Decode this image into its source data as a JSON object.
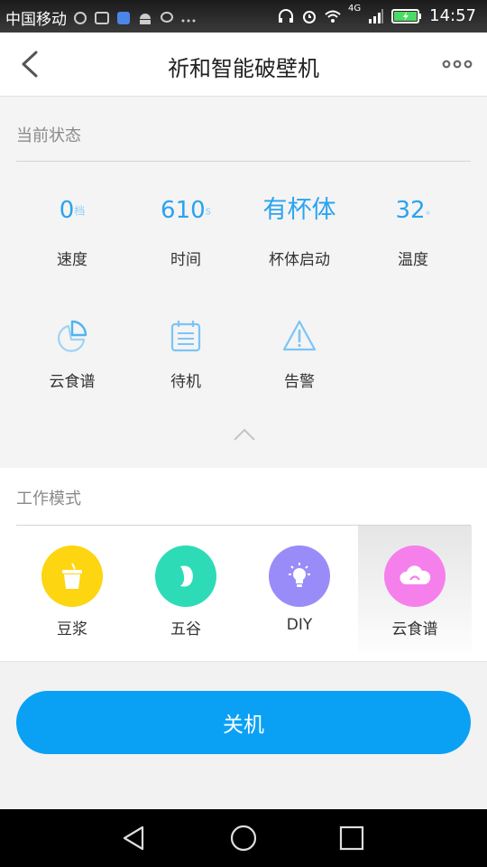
{
  "status_bar": {
    "carrier": "中国移动",
    "network": "4G",
    "time": "14:57"
  },
  "header": {
    "title": "祈和智能破壁机",
    "back_icon": "chevron-left-icon",
    "more_icon": "more-dots-icon"
  },
  "current_status": {
    "title": "当前状态",
    "stats": [
      {
        "value": "0",
        "unit": "档",
        "label": "速度"
      },
      {
        "value": "610",
        "unit": "s",
        "label": "时间"
      },
      {
        "value": "有杯体",
        "unit": "",
        "label": "杯体启动"
      },
      {
        "value": "32",
        "unit": "°",
        "label": "温度"
      }
    ],
    "actions": [
      {
        "label": "云食谱",
        "icon": "pie-chart-icon"
      },
      {
        "label": "待机",
        "icon": "calendar-list-icon"
      },
      {
        "label": "告警",
        "icon": "warning-triangle-icon"
      }
    ]
  },
  "work_mode": {
    "title": "工作模式",
    "modes": [
      {
        "label": "豆浆",
        "icon": "cup-icon",
        "color": "#fdd510"
      },
      {
        "label": "五谷",
        "icon": "bean-icon",
        "color": "#2ddbb7"
      },
      {
        "label": "DIY",
        "icon": "lightbulb-icon",
        "color": "#9a8cf8"
      },
      {
        "label": "云食谱",
        "icon": "cloud-icon",
        "color": "#f580ec"
      }
    ],
    "selected": "云食谱"
  },
  "power_button": {
    "label": "关机",
    "color": "#0aa1f5"
  },
  "accent_color": "#2aa3f0"
}
